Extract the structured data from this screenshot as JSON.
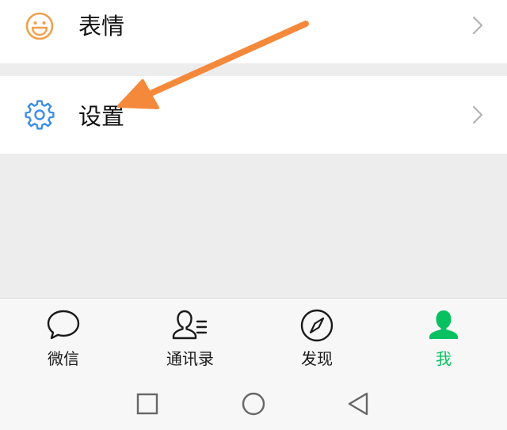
{
  "menu": {
    "items": [
      {
        "label": "表情",
        "icon": "smiley-icon",
        "icon_color": "#f0a04b"
      },
      {
        "label": "设置",
        "icon": "gear-icon",
        "icon_color": "#3a8ee6"
      }
    ]
  },
  "annotation": {
    "arrow_color": "#f5893b",
    "arrow_icon": "arrow-pointer-icon"
  },
  "tabbar": {
    "active_color": "#07c160",
    "tabs": [
      {
        "label": "微信",
        "icon": "chat-bubble-icon"
      },
      {
        "label": "通讯录",
        "icon": "contacts-icon"
      },
      {
        "label": "发现",
        "icon": "compass-icon"
      },
      {
        "label": "我",
        "icon": "person-icon",
        "active": true
      }
    ]
  },
  "system_nav": {
    "buttons": [
      "recent-apps-icon",
      "home-icon",
      "back-icon"
    ]
  }
}
